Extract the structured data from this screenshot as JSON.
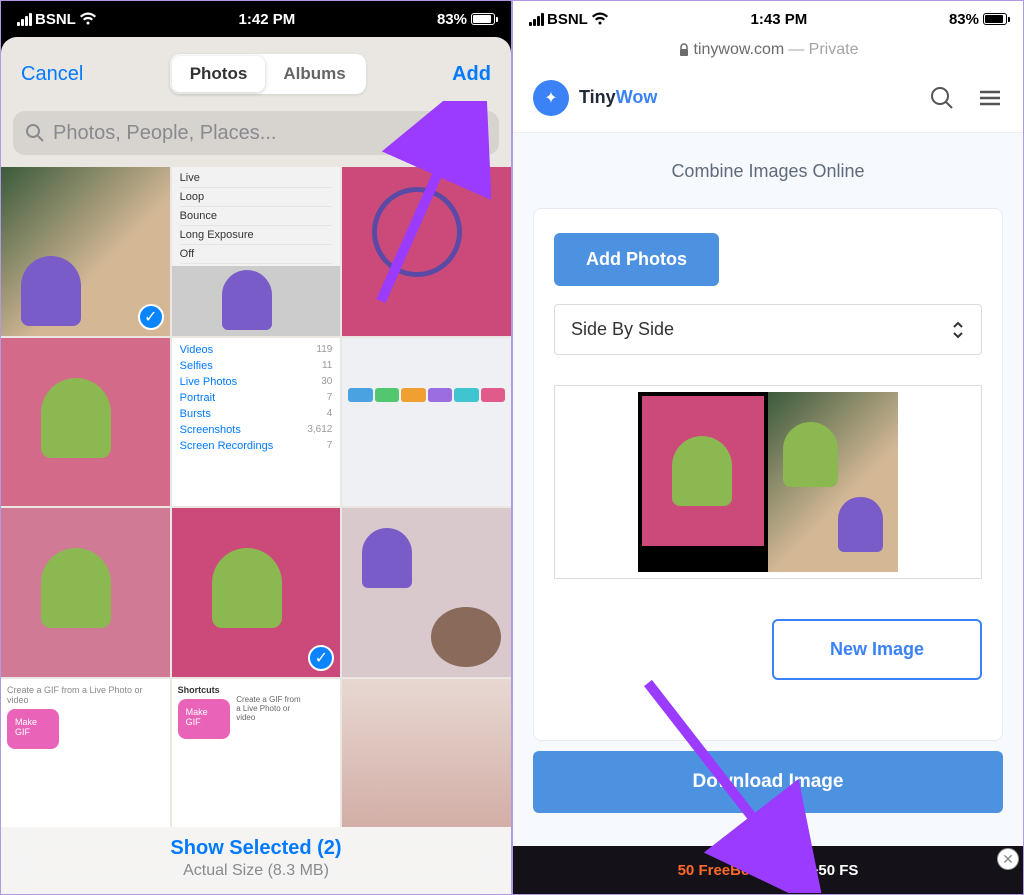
{
  "left": {
    "status": {
      "carrier": "BSNL",
      "time": "1:42 PM",
      "battery_pct": "83%",
      "battery_fill_pct": 83
    },
    "sheet": {
      "cancel": "Cancel",
      "add": "Add",
      "tabs": {
        "photos": "Photos",
        "albums": "Albums"
      },
      "search_placeholder": "Photos, People, Places...",
      "live_menu": [
        "Live",
        "Loop",
        "Bounce",
        "Long Exposure",
        "Off"
      ],
      "media_types": [
        {
          "label": "Videos",
          "count": "119"
        },
        {
          "label": "Selfies",
          "count": "11"
        },
        {
          "label": "Live Photos",
          "count": "30"
        },
        {
          "label": "Portrait",
          "count": "7"
        },
        {
          "label": "Bursts",
          "count": "4"
        },
        {
          "label": "Screenshots",
          "count": "3,612"
        },
        {
          "label": "Screen Recordings",
          "count": "7"
        }
      ],
      "shortcuts": {
        "title": "Shortcuts",
        "caption_top": "Create a GIF from a Live Photo or video",
        "make_gif": "Make GIF",
        "caption": "Create a GIF from a Live Photo or video"
      },
      "show_selected": "Show Selected (2)",
      "actual_size": "Actual Size (8.3 MB)"
    }
  },
  "right": {
    "status": {
      "carrier": "BSNL",
      "time": "1:43 PM",
      "battery_pct": "83%",
      "battery_fill_pct": 83
    },
    "url": {
      "host": "tinywow.com",
      "suffix": "— Private"
    },
    "brand": {
      "tiny": "Tiny",
      "wow": "Wow"
    },
    "subtitle": "Combine Images Online",
    "add_photos": "Add Photos",
    "select_value": "Side By Side",
    "new_image": "New Image",
    "download": "Download Image",
    "ad": {
      "orange": "50 FreeBet",
      "rest": " Aviator +50 FS"
    }
  }
}
